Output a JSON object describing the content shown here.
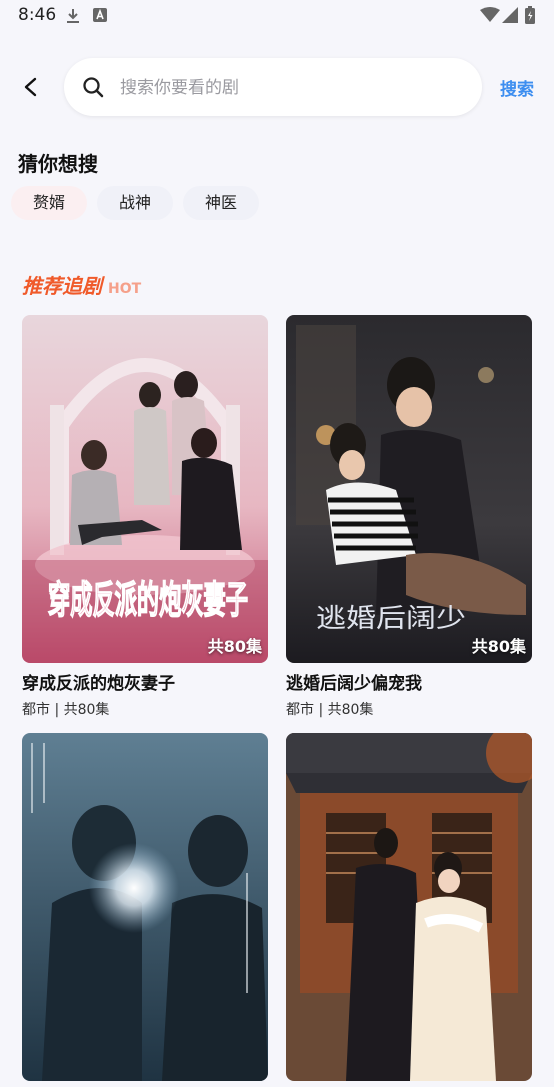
{
  "status": {
    "time": "8:46"
  },
  "search": {
    "placeholder": "搜索你要看的剧",
    "button_label": "搜索"
  },
  "suggest": {
    "title": "猜你想搜",
    "chips": [
      "赘婿",
      "战神",
      "神医"
    ]
  },
  "recommend": {
    "title": "推荐追剧",
    "tag": "HOT"
  },
  "cards": [
    {
      "title": "穿成反派的炮灰妻子",
      "meta": "都市 | 共80集",
      "badge": "共80集",
      "poster_text": "穿成反派的炮灰妻子"
    },
    {
      "title": "逃婚后阔少偏宠我",
      "meta": "都市 | 共80集",
      "badge": "共80集",
      "poster_text": "逃婚后阔少"
    },
    {
      "title": "",
      "meta": "",
      "badge": "",
      "poster_text": ""
    },
    {
      "title": "",
      "meta": "",
      "badge": "",
      "poster_text": ""
    }
  ],
  "colors": {
    "accent": "#3d8ef0",
    "hot": "#f05a2a",
    "background": "#f6f6fb"
  }
}
